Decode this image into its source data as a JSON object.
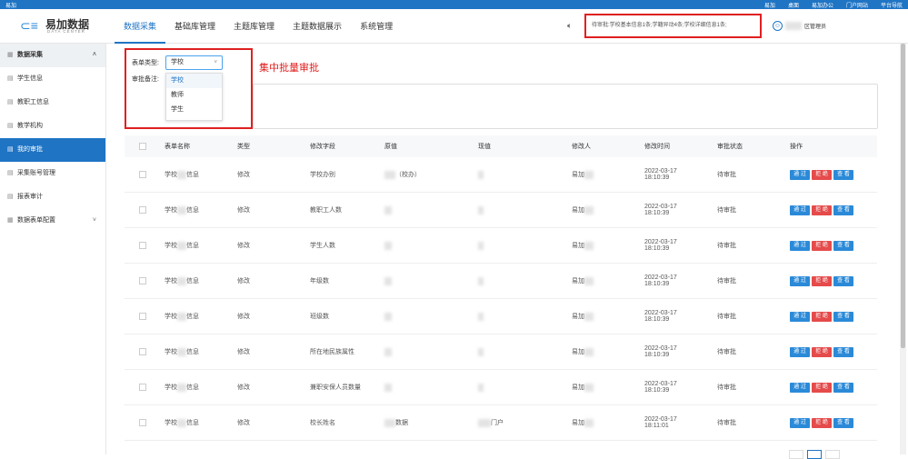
{
  "topbar": {
    "brand": "易加",
    "links": [
      "易加",
      "桌面",
      "易加办公",
      "门户网站",
      "平台导航"
    ]
  },
  "header": {
    "logo": {
      "name": "易加数据",
      "sub": "DATA CENTER"
    },
    "nav": [
      "数据采集",
      "基础库管理",
      "主题库管理",
      "主题数据展示",
      "系统管理"
    ],
    "active_nav": 0,
    "notice": "待审批:学校基本信息1条;学籍异动4条;学校详细信息1条;",
    "user": "区管理员"
  },
  "sidebar": [
    {
      "label": "数据采集",
      "icon": "grid-icon",
      "type": "group",
      "chevron": "˄"
    },
    {
      "label": "学生信息",
      "icon": "list-icon"
    },
    {
      "label": "教职工信息",
      "icon": "list-icon"
    },
    {
      "label": "教学机构",
      "icon": "list-icon"
    },
    {
      "label": "我的审批",
      "icon": "list-icon",
      "active": true
    },
    {
      "label": "采集账号管理",
      "icon": "list-icon"
    },
    {
      "label": "报表审计",
      "icon": "list-icon"
    },
    {
      "label": "数据表单配置",
      "icon": "grid-icon",
      "chevron": "˅"
    }
  ],
  "filter": {
    "type_label": "表单类型:",
    "remark_label": "审批备注:",
    "selected": "学校",
    "options": [
      "学校",
      "教师",
      "学生"
    ]
  },
  "annotation": "集中批量审批",
  "table": {
    "headers": [
      "表单名称",
      "类型",
      "修改字段",
      "原值",
      "现值",
      "修改人",
      "修改时间",
      "审批状态",
      "操作"
    ],
    "rows": [
      {
        "name": "学校",
        "name_tail": "信息",
        "type": "修改",
        "field": "学校办别",
        "old": "（校办）",
        "new": "",
        "editor": "易加",
        "date": "2022-03-17",
        "time": "18:10:39",
        "status": "待审批"
      },
      {
        "name": "学校",
        "name_tail": "信息",
        "type": "修改",
        "field": "教职工人数",
        "old": "",
        "new": "",
        "editor": "易加",
        "date": "2022-03-17",
        "time": "18:10:39",
        "status": "待审批"
      },
      {
        "name": "学校",
        "name_tail": "信息",
        "type": "修改",
        "field": "学生人数",
        "old": "",
        "new": "",
        "editor": "易加",
        "date": "2022-03-17",
        "time": "18:10:39",
        "status": "待审批"
      },
      {
        "name": "学校",
        "name_tail": "信息",
        "type": "修改",
        "field": "年级数",
        "old": "",
        "new": "",
        "editor": "易加",
        "date": "2022-03-17",
        "time": "18:10:39",
        "status": "待审批"
      },
      {
        "name": "学校",
        "name_tail": "信息",
        "type": "修改",
        "field": "班级数",
        "old": "",
        "new": "",
        "editor": "易加",
        "date": "2022-03-17",
        "time": "18:10:39",
        "status": "待审批"
      },
      {
        "name": "学校",
        "name_tail": "信息",
        "type": "修改",
        "field": "所在地民族属性",
        "old": "",
        "new": "",
        "editor": "易加",
        "date": "2022-03-17",
        "time": "18:10:39",
        "status": "待审批"
      },
      {
        "name": "学校",
        "name_tail": "信息",
        "type": "修改",
        "field": "兼职安保人员数量",
        "old": "",
        "new": "",
        "editor": "易加",
        "date": "2022-03-17",
        "time": "18:10:39",
        "status": "待审批"
      },
      {
        "name": "学校",
        "name_tail": "信息",
        "type": "修改",
        "field": "校长姓名",
        "old": "数据",
        "new": "门户",
        "editor": "易加",
        "date": "2022-03-17",
        "time": "18:11:01",
        "status": "待审批"
      }
    ],
    "actions": {
      "pass": "通 过",
      "reject": "拒 绝",
      "view": "查 看"
    }
  },
  "colors": {
    "primary": "#1f74c4",
    "danger": "#e54b4b",
    "highlight_border": "#e02020"
  }
}
